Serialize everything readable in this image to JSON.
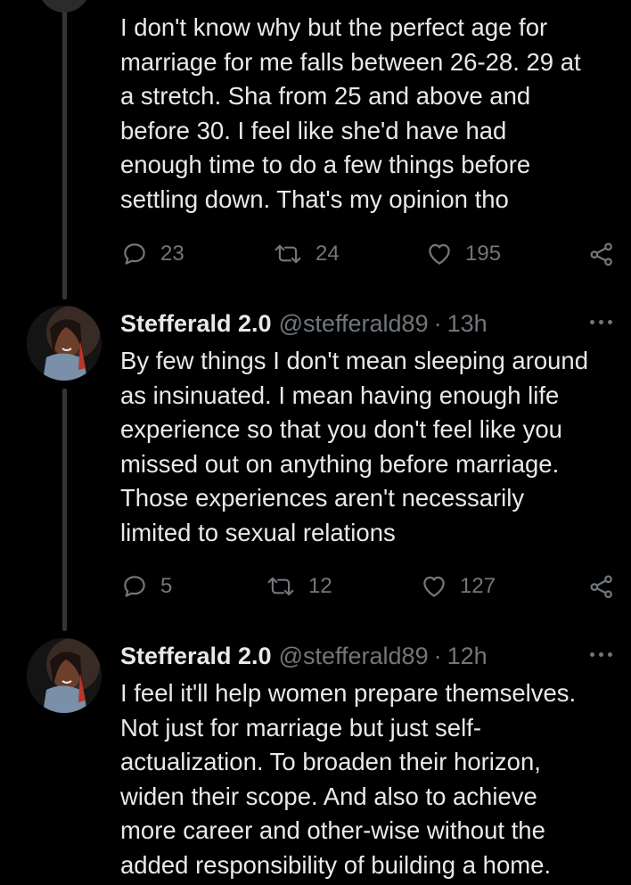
{
  "colors": {
    "background": "#000000",
    "text_primary": "#e7e9ea",
    "text_secondary": "#71767b",
    "thread_line": "#333639"
  },
  "tweets": [
    {
      "text_lines": [
        "I don't know why but the perfect age for",
        "marriage for me falls between 26-28. 29 at",
        "a stretch. Sha from 25 and above and",
        "before 30. I feel like she'd have had",
        "enough time to do a few things before",
        "settling down. That's my opinion tho"
      ],
      "replies": "23",
      "retweets": "24",
      "likes": "195"
    },
    {
      "display_name": "Stefferald 2.0",
      "handle": "@stefferald89",
      "separator": "·",
      "time": "13h",
      "text_lines": [
        "By few things I don't mean sleeping around",
        "as insinuated. I mean having enough life",
        "experience so that you don't feel like you",
        "missed out on anything before marriage.",
        "Those experiences aren't necessarily",
        "limited to sexual relations"
      ],
      "replies": "5",
      "retweets": "12",
      "likes": "127"
    },
    {
      "display_name": "Stefferald 2.0",
      "handle": "@stefferald89",
      "separator": "·",
      "time": "12h",
      "text_lines": [
        "I feel it'll help women prepare themselves.",
        "Not just for marriage but just self-",
        "actualization. To broaden their horizon,",
        "widen their scope. And also to achieve",
        "more career and other-wise without the",
        "added responsibility of building a home."
      ]
    }
  ],
  "icons": {
    "reply": "reply-icon",
    "retweet": "retweet-icon",
    "like": "heart-icon",
    "share": "share-icon",
    "more": "more-options-icon",
    "avatar": "avatar"
  }
}
